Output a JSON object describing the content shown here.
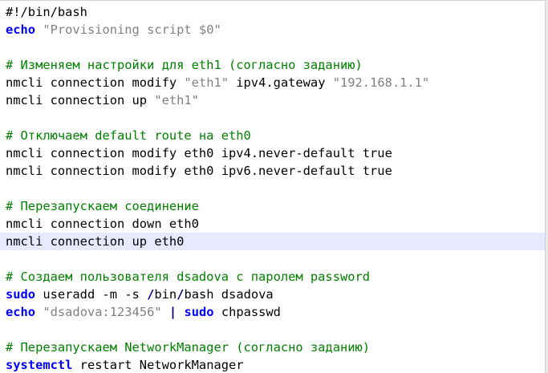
{
  "editor": {
    "lines": [
      {
        "segments": [
          {
            "t": "#!/bin/bash",
            "c": "sheb"
          }
        ]
      },
      {
        "segments": [
          {
            "t": "echo",
            "c": "kw"
          },
          {
            "t": " ",
            "c": ""
          },
          {
            "t": "\"Provisioning script $0\"",
            "c": "str"
          }
        ]
      },
      {
        "segments": []
      },
      {
        "segments": [
          {
            "t": "# Изменяем настройки для eth1 (согласно заданию)",
            "c": "cmt"
          }
        ]
      },
      {
        "segments": [
          {
            "t": "nmcli connection modify ",
            "c": ""
          },
          {
            "t": "\"eth1\"",
            "c": "str"
          },
          {
            "t": " ipv4.gateway ",
            "c": ""
          },
          {
            "t": "\"192.168.1.1\"",
            "c": "str"
          }
        ]
      },
      {
        "segments": [
          {
            "t": "nmcli connection up ",
            "c": ""
          },
          {
            "t": "\"eth1\"",
            "c": "str"
          }
        ]
      },
      {
        "segments": []
      },
      {
        "segments": [
          {
            "t": "# Отключаем default route на eth0",
            "c": "cmt"
          }
        ]
      },
      {
        "segments": [
          {
            "t": "nmcli connection modify eth0 ipv4.never-default true",
            "c": ""
          }
        ]
      },
      {
        "segments": [
          {
            "t": "nmcli connection modify eth0 ipv6.never-default true",
            "c": ""
          }
        ]
      },
      {
        "segments": []
      },
      {
        "segments": [
          {
            "t": "# Перезапускаем соединение",
            "c": "cmt"
          }
        ]
      },
      {
        "segments": [
          {
            "t": "nmcli connection down eth0",
            "c": ""
          }
        ]
      },
      {
        "segments": [
          {
            "t": "nmcli connection up eth0",
            "c": ""
          }
        ],
        "current": true
      },
      {
        "segments": []
      },
      {
        "segments": [
          {
            "t": "# Создаем пользователя dsadova с паролем password",
            "c": "cmt"
          }
        ]
      },
      {
        "segments": [
          {
            "t": "sudo",
            "c": "kw"
          },
          {
            "t": " useradd -m -s ",
            "c": ""
          },
          {
            "t": "/",
            "c": "op"
          },
          {
            "t": "bin",
            "c": ""
          },
          {
            "t": "/",
            "c": "op"
          },
          {
            "t": "bash dsadova",
            "c": ""
          }
        ]
      },
      {
        "segments": [
          {
            "t": "echo",
            "c": "kw"
          },
          {
            "t": " ",
            "c": ""
          },
          {
            "t": "\"dsadova:123456\"",
            "c": "str"
          },
          {
            "t": " ",
            "c": ""
          },
          {
            "t": "|",
            "c": "op"
          },
          {
            "t": " ",
            "c": ""
          },
          {
            "t": "sudo",
            "c": "kw"
          },
          {
            "t": " chpasswd",
            "c": ""
          }
        ]
      },
      {
        "segments": []
      },
      {
        "segments": [
          {
            "t": "# Перезапускаем NetworkManager (согласно заданию)",
            "c": "cmt"
          }
        ]
      },
      {
        "segments": [
          {
            "t": "systemctl",
            "c": "kw"
          },
          {
            "t": " restart NetworkManager",
            "c": ""
          }
        ]
      }
    ],
    "colors": {
      "keyword": "#0000ff",
      "string": "#808080",
      "comment": "#008000",
      "operator": "#000080",
      "current_line": "#e8e8ff"
    }
  }
}
